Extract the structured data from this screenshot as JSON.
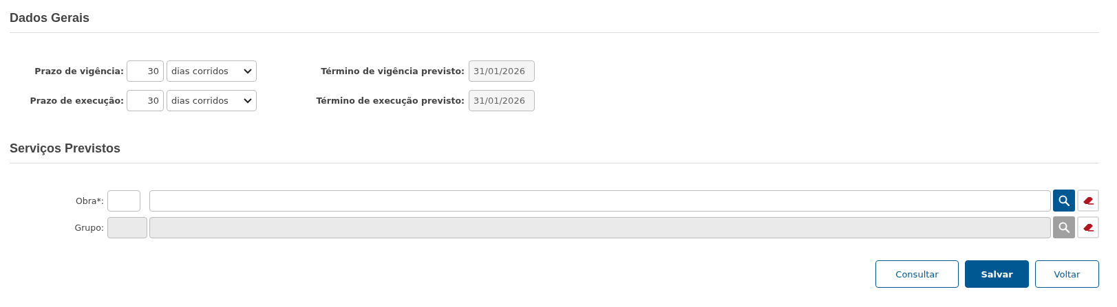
{
  "sections": [
    {
      "title": "Dados Gerais",
      "kind": "terms",
      "rows": [
        {
          "label": "Prazo de vigência:",
          "amount": "30",
          "unit": "dias corridos",
          "end_label": "Término de vigência previsto:",
          "end_date": "31/01/2026",
          "end_readonly": true
        },
        {
          "label": "Prazo de execução:",
          "amount": "30",
          "unit": "dias corridos",
          "end_label": "Término de execução previsto:",
          "end_date": "31/01/2026",
          "end_readonly": true
        }
      ]
    },
    {
      "title": "Serviços Previstos",
      "kind": "lookups",
      "rows": [
        {
          "label": "Obra*:",
          "disabled": false
        },
        {
          "label": "Grupo:",
          "disabled": true
        }
      ]
    }
  ],
  "buttons": [
    {
      "label": "Consultar",
      "primary": false
    },
    {
      "label": "Salvar",
      "primary": true
    },
    {
      "label": "Voltar",
      "primary": false
    }
  ]
}
